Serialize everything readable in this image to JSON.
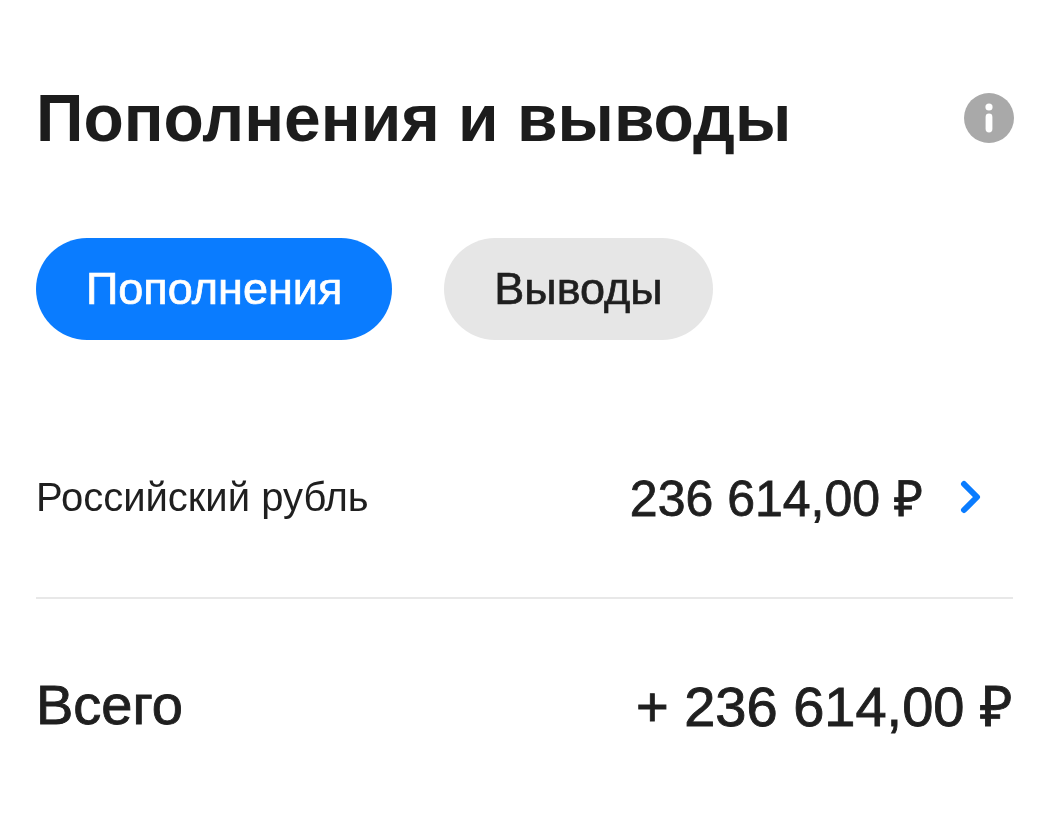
{
  "header": {
    "title": "Пополнения и выводы"
  },
  "tabs": [
    {
      "label": "Пополнения",
      "selected": true
    },
    {
      "label": "Выводы",
      "selected": false
    }
  ],
  "currencies": [
    {
      "name": "Российский рубль",
      "amount": "236 614,00 ₽"
    }
  ],
  "total": {
    "label": "Всего",
    "amount": "+ 236 614,00 ₽"
  }
}
